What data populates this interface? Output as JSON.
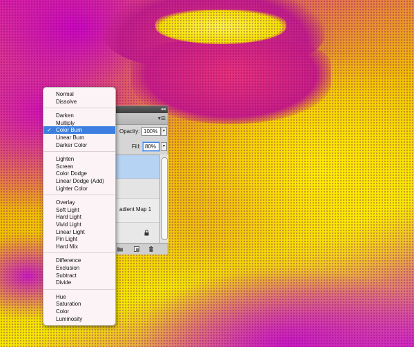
{
  "blend_menu": {
    "groups": [
      [
        "Normal",
        "Dissolve"
      ],
      [
        "Darken",
        "Multiply",
        "Color Burn",
        "Linear Burn",
        "Darker Color"
      ],
      [
        "Lighten",
        "Screen",
        "Color Dodge",
        "Linear Dodge (Add)",
        "Lighter Color"
      ],
      [
        "Overlay",
        "Soft Light",
        "Hard Light",
        "Vivid Light",
        "Linear Light",
        "Pin Light",
        "Hard Mix"
      ],
      [
        "Difference",
        "Exclusion",
        "Subtract",
        "Divide"
      ],
      [
        "Hue",
        "Saturation",
        "Color",
        "Luminosity"
      ]
    ],
    "selected": "Color Burn",
    "check_glyph": "✓"
  },
  "layers_panel": {
    "collapse_glyph": "◂◂",
    "menu_glyph": "▾☰",
    "opacity_label": "Opacity:",
    "opacity_value": "100%",
    "fill_label": "Fill:",
    "fill_value": "80%",
    "arrow_glyph": "▾",
    "layer_partial_label": "adient Map 1"
  },
  "colors": {
    "accent": "#3d7fe0",
    "selected_layer": "#b7d3f3",
    "magenta": "#d81fa6",
    "yellow": "#f4ea00"
  }
}
